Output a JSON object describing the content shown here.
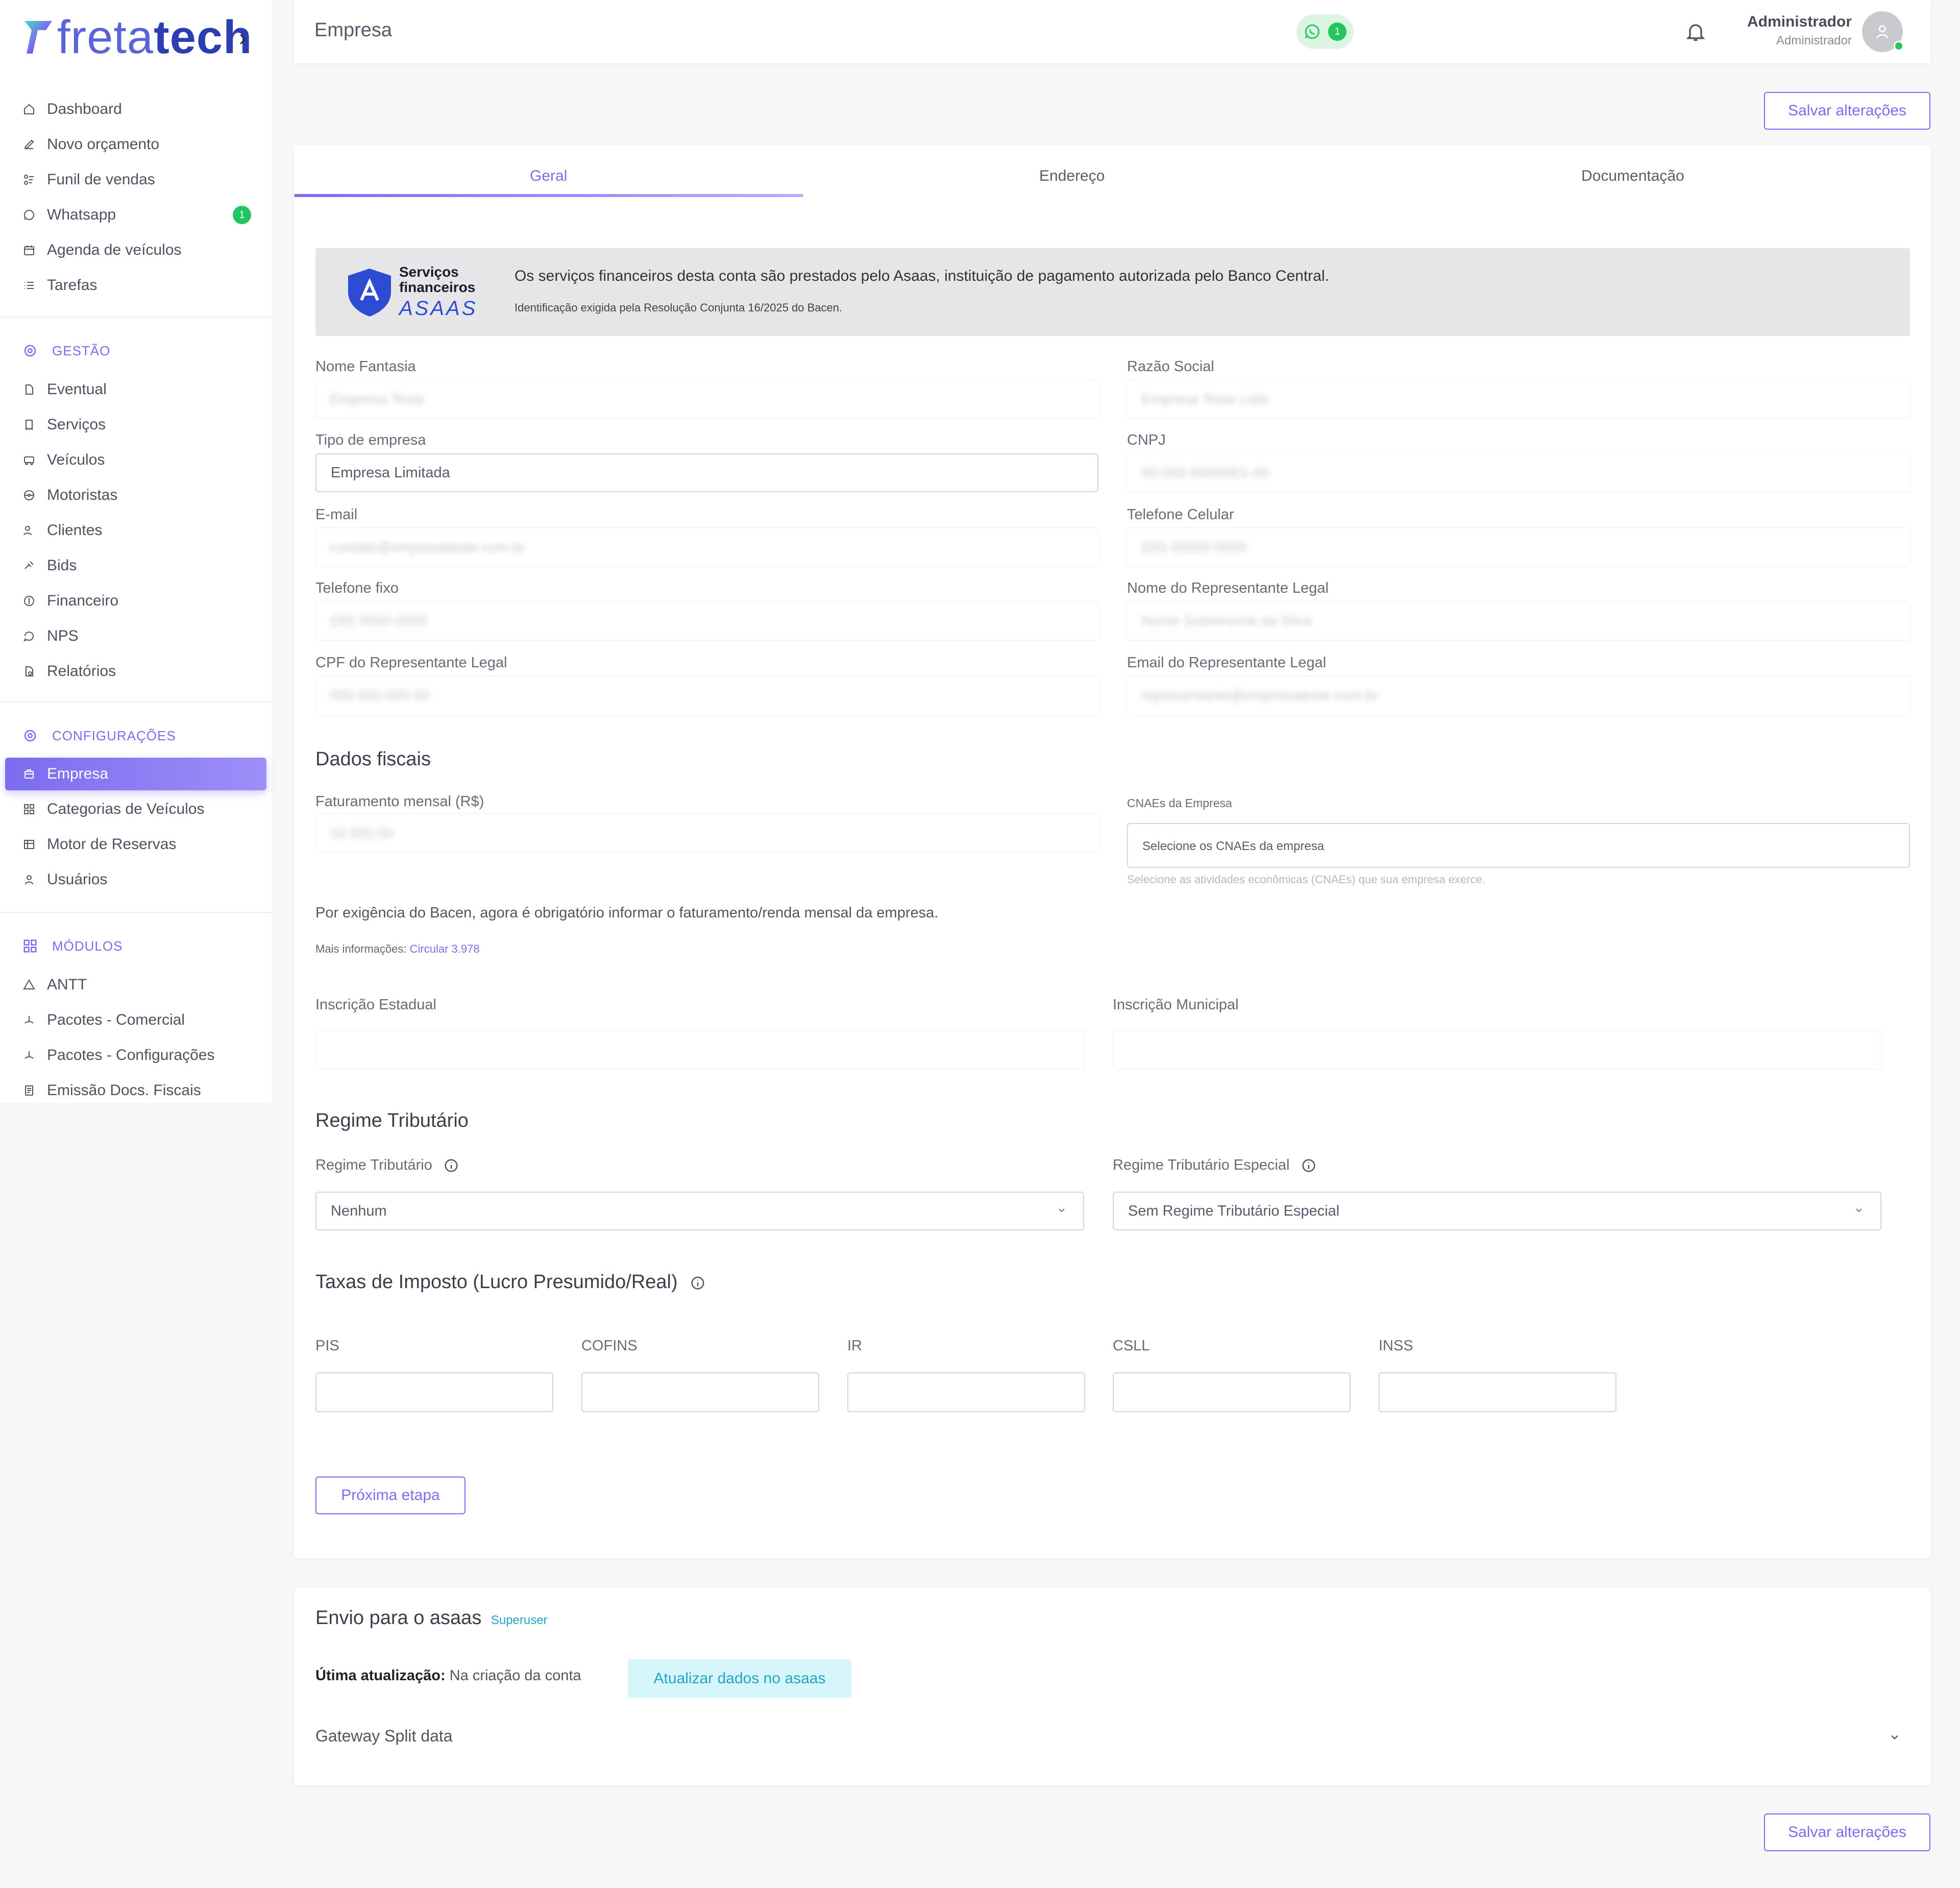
{
  "brand": {
    "part1": "freta",
    "part2": "tech"
  },
  "sidebar": {
    "items_top": [
      {
        "label": "Dashboard",
        "icon": "home-icon"
      },
      {
        "label": "Novo orçamento",
        "icon": "edit-icon"
      },
      {
        "label": "Funil de vendas",
        "icon": "funnel-icon"
      },
      {
        "label": "Whatsapp",
        "icon": "whatsapp-icon",
        "badge": "1"
      },
      {
        "label": "Agenda de veículos",
        "icon": "calendar-icon"
      },
      {
        "label": "Tarefas",
        "icon": "list-icon"
      }
    ],
    "section_gestao": "GESTÃO",
    "items_gestao": [
      {
        "label": "Eventual",
        "icon": "file-icon"
      },
      {
        "label": "Serviços",
        "icon": "receipt-icon"
      },
      {
        "label": "Veículos",
        "icon": "bus-icon"
      },
      {
        "label": "Motoristas",
        "icon": "steering-icon"
      },
      {
        "label": "Clientes",
        "icon": "users-icon"
      },
      {
        "label": "Bids",
        "icon": "gavel-icon"
      },
      {
        "label": "Financeiro",
        "icon": "dollar-icon"
      },
      {
        "label": "NPS",
        "icon": "chat-icon"
      },
      {
        "label": "Relatórios",
        "icon": "report-icon"
      }
    ],
    "section_config": "CONFIGURAÇÕES",
    "items_config": [
      {
        "label": "Empresa",
        "icon": "building-icon",
        "active": true
      },
      {
        "label": "Categorias de Veículos",
        "icon": "grid-icon"
      },
      {
        "label": "Motor de Reservas",
        "icon": "table-icon"
      },
      {
        "label": "Usuários",
        "icon": "user-icon"
      }
    ],
    "section_modulos": "MÓDULOS",
    "items_modulos": [
      {
        "label": "ANTT",
        "icon": "triangle-icon"
      },
      {
        "label": "Pacotes - Comercial",
        "icon": "package-icon"
      },
      {
        "label": "Pacotes - Configurações",
        "icon": "package-icon"
      },
      {
        "label": "Emissão Docs. Fiscais",
        "icon": "document-icon"
      }
    ]
  },
  "header": {
    "title": "Empresa",
    "whatsapp_badge": "1",
    "user_name": "Administrador",
    "user_role": "Administrador"
  },
  "actions": {
    "save_label": "Salvar alterações"
  },
  "tabs": [
    {
      "label": "Geral",
      "active": true
    },
    {
      "label": "Endereço"
    },
    {
      "label": "Documentação"
    }
  ],
  "asaas_banner": {
    "logo_line1": "Serviços",
    "logo_line2": "financeiros",
    "logo_brand": "ASAAS",
    "main_text": "Os serviços financeiros desta conta são prestados pelo Asaas, instituição de pagamento autorizada pelo Banco Central.",
    "sub_text": "Identificação exigida pela Resolução Conjunta 16/2025 do Bacen."
  },
  "form": {
    "nome_fantasia": {
      "label": "Nome Fantasia",
      "value": "Empresa Teste"
    },
    "razao_social": {
      "label": "Razão Social",
      "value": "Empresa Teste Ltda"
    },
    "tipo_empresa": {
      "label": "Tipo de empresa",
      "value": "Empresa Limitada"
    },
    "cnpj": {
      "label": "CNPJ",
      "value": "00.000.000/0001-00"
    },
    "email": {
      "label": "E-mail",
      "value": "contato@empresateste.com.br"
    },
    "telefone_celular": {
      "label": "Telefone Celular",
      "value": "(00) 00000-0000"
    },
    "telefone_fixo": {
      "label": "Telefone fixo",
      "value": "(00) 0000-0000"
    },
    "nome_representante": {
      "label": "Nome do Representante Legal",
      "value": "Nome Sobrenome da Silva"
    },
    "cpf_representante": {
      "label": "CPF do Representante Legal",
      "value": "000.000.000-00"
    },
    "email_representante": {
      "label": "Email do Representante Legal",
      "value": "representante@empresateste.com.br"
    }
  },
  "fiscal": {
    "title": "Dados fiscais",
    "faturamento_label": "Faturamento mensal (R$)",
    "faturamento_value": "10.000,00",
    "cnaes_label": "CNAEs da Empresa",
    "cnaes_placeholder": "Selecione os CNAEs da empresa",
    "cnaes_help": "Selecione as atividades econômicas (CNAEs) que sua empresa exerce.",
    "bacen_note": "Por exigência do Bacen, agora é obrigatório informar o faturamento/renda mensal da empresa.",
    "more_info_prefix": "Mais informações:",
    "more_info_link": "Circular 3.978",
    "inscricao_estadual_label": "Inscrição Estadual",
    "inscricao_municipal_label": "Inscrição Municipal"
  },
  "regime": {
    "title": "Regime Tributário",
    "regime_label": "Regime Tributário",
    "regime_value": "Nenhum",
    "especial_label": "Regime Tributário Especial",
    "especial_value": "Sem Regime Tributário Especial"
  },
  "taxas": {
    "title": "Taxas de Imposto (Lucro Presumido/Real)",
    "fields": [
      "PIS",
      "COFINS",
      "IR",
      "CSLL",
      "INSS"
    ]
  },
  "next_step_label": "Próxima etapa",
  "asaas_send": {
    "title": "Envio para o asaas",
    "tag": "Superuser",
    "last_update_label": "Útima atualização:",
    "last_update_value": "Na criação da conta",
    "update_button": "Atualizar dados no asaas",
    "gateway_label": "Gateway Split data"
  },
  "colors": {
    "accent": "#7c6cf0",
    "whatsapp_green": "#22c55e",
    "asaas_blue": "#2e4bd4",
    "cyan": "#21a6c5"
  }
}
